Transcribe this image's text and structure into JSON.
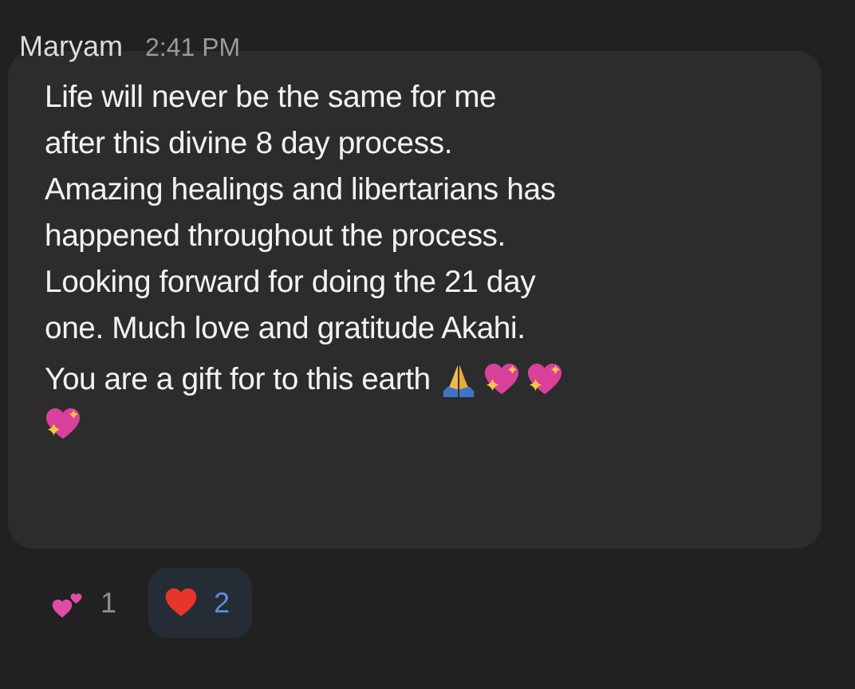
{
  "message": {
    "sender": "Maryam",
    "time": "2:41 PM",
    "lines": [
      "Life will never be the same for me",
      "after this divine 8 day process.",
      "Amazing healings and libertarians has",
      "happened throughout the process.",
      "Looking forward for doing the 21 day",
      "one. Much love and gratitude Akahi.",
      "You are a gift for to this earth"
    ]
  },
  "reactions": [
    {
      "kind": "two-hearts",
      "count": "1",
      "selected": false
    },
    {
      "kind": "heart",
      "count": "2",
      "selected": true
    }
  ]
}
